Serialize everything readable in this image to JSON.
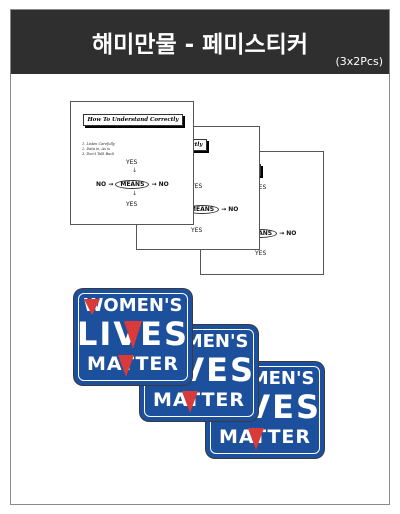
{
  "header": {
    "title": "해미만물 - 페미스티커",
    "subtitle": "(3x2Pcs)"
  },
  "document_sticker": {
    "title": "How To Understand Correctly",
    "list": [
      "1. Listen Carefully",
      "2. Data in, As is",
      "3. Don't Talk Back"
    ],
    "yes": "YES",
    "no": "NO",
    "means": "MEANS"
  },
  "women_sticker": {
    "line1": "WOMEN'S",
    "line2": "LIVES",
    "line3": "MATTER"
  },
  "colors": {
    "header_bg": "#2f2f2f",
    "sticker_blue": "#1c4f9c",
    "stripe_red": "#d93a3a"
  }
}
